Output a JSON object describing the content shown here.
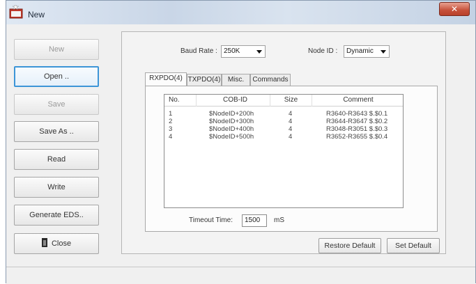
{
  "window": {
    "title": "New"
  },
  "sidebar": {
    "buttons": [
      {
        "label": "New",
        "enabled": false
      },
      {
        "label": "Open ..",
        "enabled": true,
        "focused": true
      },
      {
        "label": "Save",
        "enabled": false
      },
      {
        "label": "Save As ..",
        "enabled": true
      },
      {
        "label": "Read",
        "enabled": true
      },
      {
        "label": "Write",
        "enabled": true
      },
      {
        "label": "Generate EDS..",
        "enabled": true
      },
      {
        "label": "Close",
        "enabled": true
      }
    ]
  },
  "settings": {
    "baud_rate_label": "Baud Rate :",
    "baud_rate_value": "250K",
    "node_id_label": "Node ID :",
    "node_id_value": "Dynamic"
  },
  "tabs": [
    "RXPDO(4)",
    "TXPDO(4)",
    "Misc.",
    "Commands"
  ],
  "pdo_table": {
    "columns": [
      "No.",
      "COB-ID",
      "Size",
      "Comment"
    ],
    "rows": [
      [
        "1",
        "$NodeID+200h",
        "4",
        "R3640-R3643 $.$0.1"
      ],
      [
        "2",
        "$NodeID+300h",
        "4",
        "R3644-R3647 $.$0.2"
      ],
      [
        "3",
        "$NodeID+400h",
        "4",
        "R3048-R3051 $.$0.3"
      ],
      [
        "4",
        "$NodeID+500h",
        "4",
        "R3652-R3655 $.$0.4"
      ]
    ]
  },
  "timeout": {
    "label": "Timeout Time:",
    "value": "1500",
    "unit": "mS"
  },
  "actions": {
    "restore_default": "Restore Default",
    "set_default": "Set Default"
  },
  "colors": {
    "focus_border": "#3d95d7",
    "close_button": "#c6503a"
  },
  "icons": {
    "app": "app-window-icon",
    "close_window": "close-x-icon",
    "close_button": "door-icon"
  }
}
